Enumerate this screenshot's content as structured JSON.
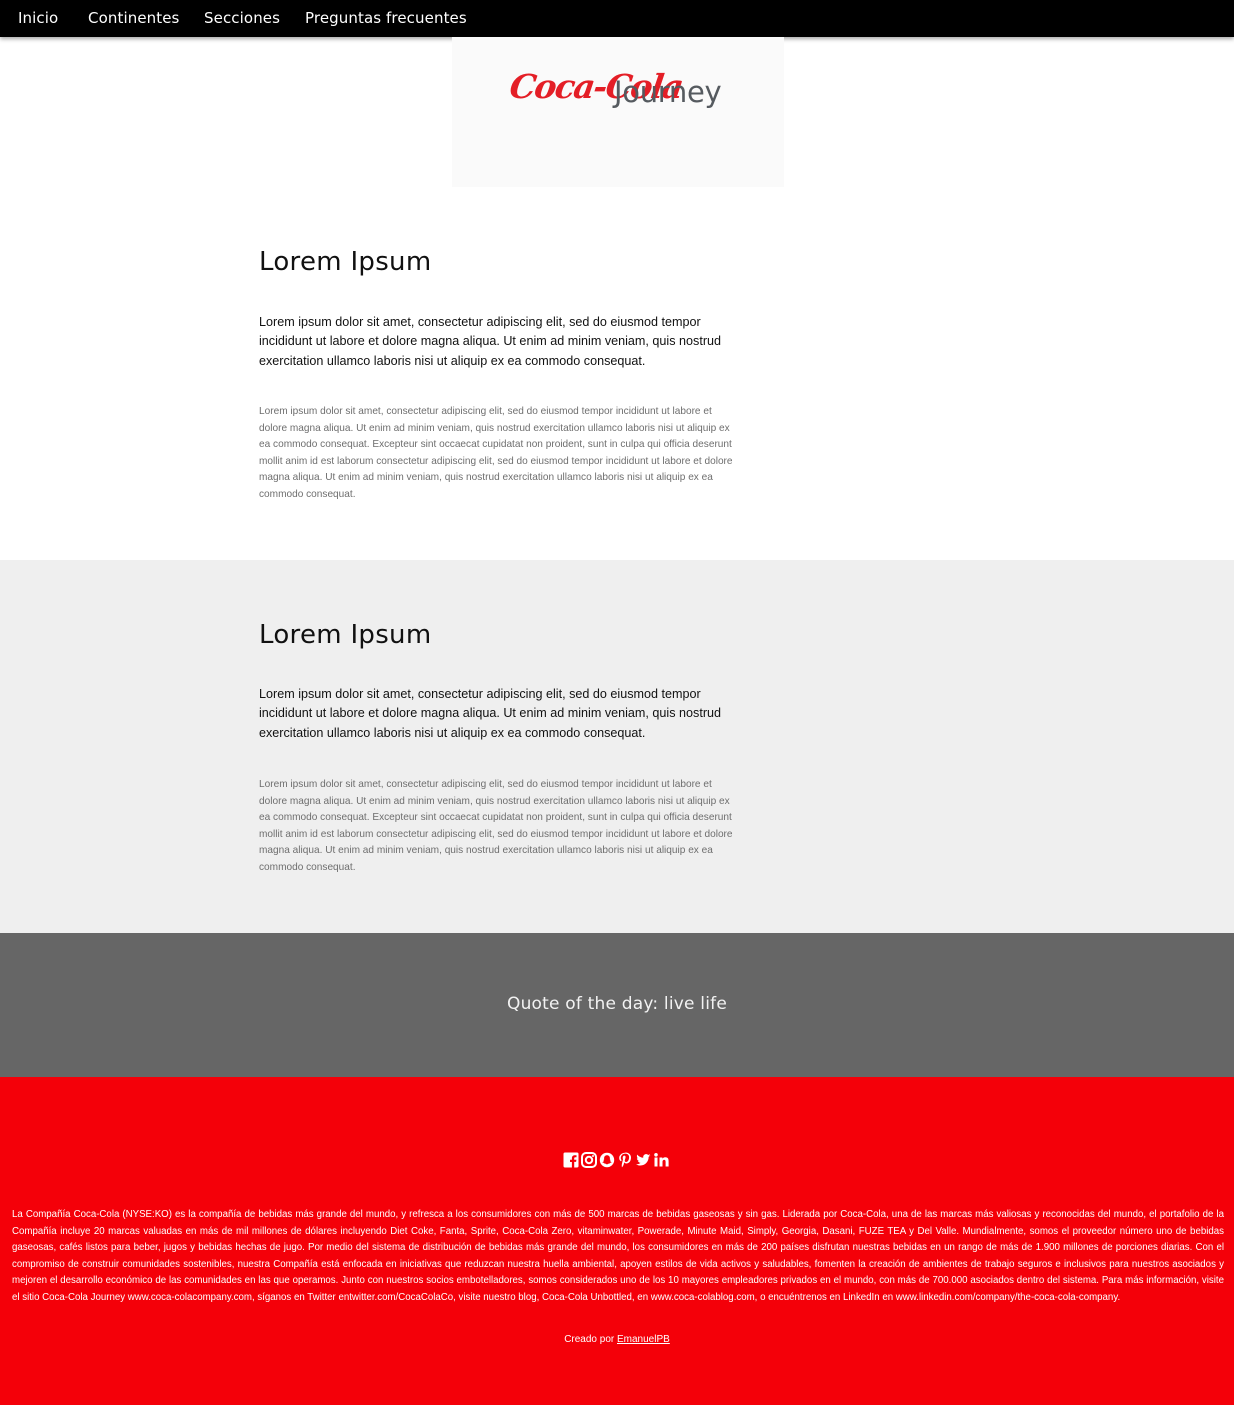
{
  "nav": {
    "items": [
      {
        "label": "Inicio"
      },
      {
        "label": "Continentes"
      },
      {
        "label": "Secciones"
      },
      {
        "label": "Preguntas frecuentes"
      }
    ]
  },
  "logo": {
    "brand": "Coca-Cola",
    "suffix": "Journey"
  },
  "sections": [
    {
      "title": "Lorem Ipsum",
      "lead": "Lorem ipsum dolor sit amet, consectetur adipiscing elit, sed do eiusmod tempor incididunt ut labore et dolore magna aliqua. Ut enim ad minim veniam, quis nostrud exercitation ullamco laboris nisi ut aliquip ex ea commodo consequat.",
      "body": "Lorem ipsum dolor sit amet, consectetur adipiscing elit, sed do eiusmod tempor incididunt ut labore et dolore magna aliqua. Ut enim ad minim veniam, quis nostrud exercitation ullamco laboris nisi ut aliquip ex ea commodo consequat. Excepteur sint occaecat cupidatat non proident, sunt in culpa qui officia deserunt mollit anim id est laborum consectetur adipiscing elit, sed do eiusmod tempor incididunt ut labore et dolore magna aliqua. Ut enim ad minim veniam, quis nostrud exercitation ullamco laboris nisi ut aliquip ex ea commodo consequat."
    },
    {
      "title": "Lorem Ipsum",
      "lead": "Lorem ipsum dolor sit amet, consectetur adipiscing elit, sed do eiusmod tempor incididunt ut labore et dolore magna aliqua. Ut enim ad minim veniam, quis nostrud exercitation ullamco laboris nisi ut aliquip ex ea commodo consequat.",
      "body": "Lorem ipsum dolor sit amet, consectetur adipiscing elit, sed do eiusmod tempor incididunt ut labore et dolore magna aliqua. Ut enim ad minim veniam, quis nostrud exercitation ullamco laboris nisi ut aliquip ex ea commodo consequat. Excepteur sint occaecat cupidatat non proident, sunt in culpa qui officia deserunt mollit anim id est laborum consectetur adipiscing elit, sed do eiusmod tempor incididunt ut labore et dolore magna aliqua. Ut enim ad minim veniam, quis nostrud exercitation ullamco laboris nisi ut aliquip ex ea commodo consequat."
    }
  ],
  "quote": {
    "text": "Quote of the day: live life"
  },
  "footer": {
    "social_icons": [
      "facebook-icon",
      "instagram-icon",
      "snapchat-icon",
      "pinterest-icon",
      "twitter-icon",
      "linkedin-icon"
    ],
    "about": "La Compañía Coca-Cola (NYSE:KO) es la compañía de bebidas más grande del mundo, y refresca a los consumidores con más de 500 marcas de bebidas gaseosas y sin gas. Liderada por Coca-Cola, una de las marcas más valiosas y reconocidas del mundo, el portafolio de la Compañía incluye 20 marcas valuadas en más de mil millones de dólares incluyendo Diet Coke, Fanta, Sprite, Coca-Cola Zero, vitaminwater, Powerade, Minute Maid, Simply, Georgia, Dasani, FUZE TEA y Del Valle. Mundialmente, somos el proveedor número uno de bebidas gaseosas, cafés listos para beber, jugos y bebidas hechas de jugo. Por medio del sistema de distribución de bebidas más grande del mundo, los consumidores en más de 200 países disfrutan nuestras bebidas en un rango de más de 1.900 millones de porciones diarias. Con el compromiso de construir comunidades sostenibles, nuestra Compañía está enfocada en iniciativas que reduzcan nuestra huella ambiental, apoyen estilos de vida activos y saludables, fomenten la creación de ambientes de trabajo seguros e inclusivos para nuestros asociados y mejoren el desarrollo económico de las comunidades en las que operamos. Junto con nuestros socios embotelladores, somos considerados uno de los 10 mayores empleadores privados en el mundo, con más de 700.000 asociados dentro del sistema. Para más información, visite el sitio Coca-Cola Journey www.coca-colacompany.com, síganos en Twitter entwitter.com/CocaColaCo, visite nuestro blog, Coca-Cola Unbottled, en www.coca-colablog.com, o encuéntrenos en LinkedIn en www.linkedin.com/company/the-coca-cola-company.",
    "credit_prefix": "Creado por",
    "credit_link": "EmanuelPB"
  },
  "colors": {
    "nav_bg": "#000000",
    "section_alt_bg": "#efefef",
    "quote_bg": "#666666",
    "footer_bg": "#f40009",
    "brand_red": "#e41e26"
  }
}
